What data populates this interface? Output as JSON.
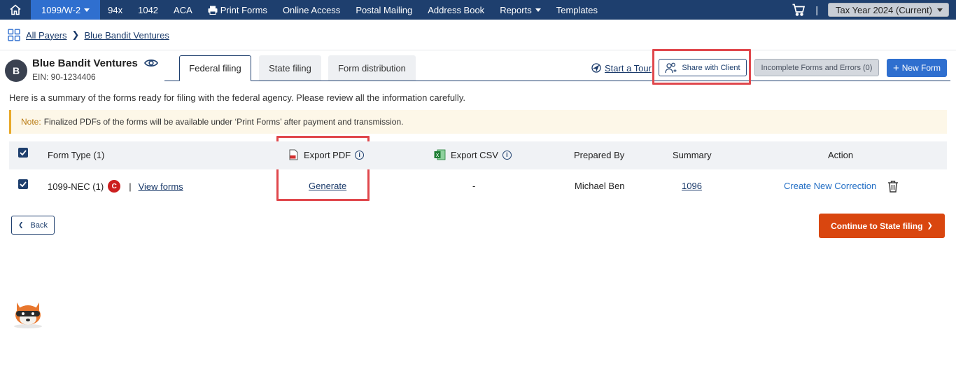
{
  "nav": {
    "items": [
      {
        "label": "1099/W-2",
        "has_caret": true,
        "active": true
      },
      {
        "label": "94x"
      },
      {
        "label": "1042"
      },
      {
        "label": "ACA"
      },
      {
        "label": "Print Forms",
        "icon": "printer-icon"
      },
      {
        "label": "Online Access"
      },
      {
        "label": "Postal Mailing"
      },
      {
        "label": "Address Book"
      },
      {
        "label": "Reports",
        "has_caret": true
      },
      {
        "label": "Templates"
      }
    ],
    "separator": "|",
    "tax_year": "Tax Year 2024 (Current)"
  },
  "breadcrumb": {
    "all_payers": "All Payers",
    "current": "Blue Bandit Ventures"
  },
  "payer": {
    "initial": "B",
    "name": "Blue Bandit Ventures",
    "ein": "EIN: 90-1234406"
  },
  "tabs": [
    {
      "label": "Federal filing",
      "active": true
    },
    {
      "label": "State filing"
    },
    {
      "label": "Form distribution"
    }
  ],
  "actions": {
    "tour": "Start a Tour",
    "share": "Share with Client",
    "incomplete": "Incomplete Forms and Errors (0)",
    "new_form": "New Form"
  },
  "summary_text": "Here is a summary of the forms ready for filing with the federal agency. Please review all the information carefully.",
  "note": {
    "label": "Note:",
    "text": "Finalized PDFs of the forms will be available under ‘Print Forms’ after payment and transmission."
  },
  "table": {
    "headers": {
      "form_type": "Form Type  (1)",
      "export_pdf": "Export PDF",
      "export_csv": "Export CSV",
      "prepared_by": "Prepared By",
      "summary": "Summary",
      "action": "Action"
    },
    "row": {
      "form": "1099-NEC (1)",
      "badge": "C",
      "divider": "|",
      "view_forms": "View forms",
      "export_pdf": "Generate",
      "export_csv": "-",
      "prepared_by": "Michael Ben",
      "summary": "1096",
      "action": "Create New Correction"
    }
  },
  "footer": {
    "back": "Back",
    "continue": "Continue to State filing"
  },
  "colors": {
    "nav_bg": "#1e3f6e",
    "nav_active": "#2f6fcf",
    "primary_button": "#2f6fcf",
    "continue_button": "#d9460f",
    "highlight_box": "#e0474c",
    "badge_red": "#cc1f1f"
  }
}
